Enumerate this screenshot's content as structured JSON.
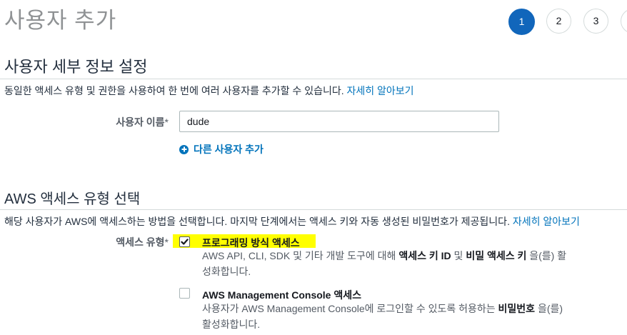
{
  "page": {
    "title": "사용자 추가"
  },
  "stepper": {
    "steps": [
      "1",
      "2",
      "3"
    ],
    "active_step": "1"
  },
  "details": {
    "title": "사용자 세부 정보 설정",
    "description": "동일한 액세스 유형 및 권한을 사용하여 한 번에 여러 사용자를 추가할 수 있습니다.",
    "learn_more": "자세히 알아보기",
    "username_label": "사용자 이름",
    "required_mark": "*",
    "username_value": "dude",
    "add_user": "다른 사용자 추가"
  },
  "access": {
    "title": "AWS 액세스 유형 선택",
    "description": "해당 사용자가 AWS에 액세스하는 방법을 선택합니다. 마지막 단계에서는 액세스 키와 자동 생성된 비밀번호가 제공됩니다.",
    "learn_more": "자세히 알아보기",
    "type_label": "액세스 유형",
    "required_mark": "*",
    "options": [
      {
        "title": "프로그래밍 방식 액세스",
        "checked": true,
        "desc_parts": [
          "AWS API, CLI, SDK 및 기타 개발 도구에 대해 ",
          "액세스 키 ID",
          " 및 ",
          "비밀 액세스 키",
          " 을(를) 활",
          "성화합니다."
        ]
      },
      {
        "title": "AWS Management Console 액세스",
        "checked": false,
        "desc_parts": [
          "사용자가 AWS Management Console에 로그인할 수 있도록 허용하는 ",
          "비밀번호",
          " 을(를)",
          "활성화합니다."
        ]
      }
    ]
  },
  "colors": {
    "accent": "#1166bb",
    "link": "#0073bb",
    "highlight": "#ffff00"
  }
}
